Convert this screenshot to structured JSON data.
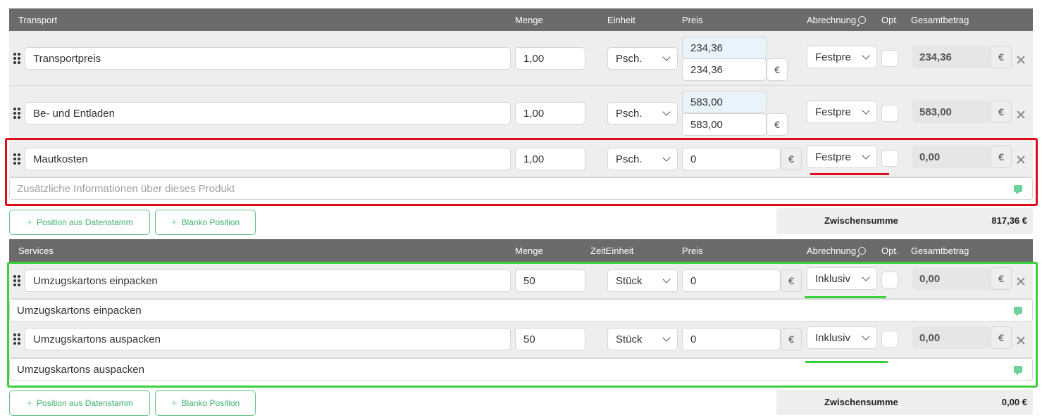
{
  "colors": {
    "header_bg": "#6b6b6b",
    "accent_green": "#39b26a",
    "annotation_red": "#e00b1c",
    "annotation_green": "#3ad03a",
    "price_highlight": "#e9f3fb"
  },
  "icons": {
    "drag": "drag-handle-icon",
    "chevron": "chevron-down-icon",
    "remove": "close-icon",
    "note": "message-icon",
    "lookup": "search-icon",
    "add": "plus-icon"
  },
  "transport": {
    "header": {
      "title": "Transport",
      "qty": "Menge",
      "unit": "Einheit",
      "price": "Preis",
      "billing": "Abrechnung",
      "opt": "Opt.",
      "total": "Gesamtbetrag"
    },
    "items": [
      {
        "name": "Transportpreis",
        "qty": "1,00",
        "unit": "Psch.",
        "price_suggested": "234,36",
        "price": "234,36",
        "currency": "€",
        "billing": "Festpre",
        "total": "234,36"
      },
      {
        "name": "Be- und Entladen",
        "qty": "1,00",
        "unit": "Psch.",
        "price_suggested": "583,00",
        "price": "583,00",
        "currency": "€",
        "billing": "Festpre",
        "total": "583,00"
      },
      {
        "name": "Mautkosten",
        "qty": "1,00",
        "unit": "Psch.",
        "price": "0",
        "currency": "€",
        "billing": "Festpre",
        "total": "0,00",
        "info_placeholder": "Zusätzliche Informationen über dieses Produkt"
      }
    ],
    "btn_master": "Position aus Datenstamm",
    "btn_blank": "Blanko Position",
    "subtotal_label": "Zwischensumme",
    "subtotal_value": "817,36 €"
  },
  "services": {
    "header": {
      "title": "Services",
      "qty": "Menge",
      "unit": "ZeitEinheit",
      "price": "Preis",
      "billing": "Abrechnung",
      "opt": "Opt.",
      "total": "Gesamtbetrag"
    },
    "items": [
      {
        "name": "Umzugskartons einpacken",
        "qty": "50",
        "unit": "Stück",
        "price": "0",
        "currency": "€",
        "billing": "Inklusiv",
        "total": "0,00",
        "info": "Umzugskartons einpacken"
      },
      {
        "name": "Umzugskartons auspacken",
        "qty": "50",
        "unit": "Stück",
        "price": "0",
        "currency": "€",
        "billing": "Inklusiv",
        "total": "0,00",
        "info": "Umzugskartons auspacken"
      }
    ],
    "btn_master": "Position aus Datenstamm",
    "btn_blank": "Blanko Position",
    "subtotal_label": "Zwischensumme",
    "subtotal_value": "0,00 €"
  }
}
